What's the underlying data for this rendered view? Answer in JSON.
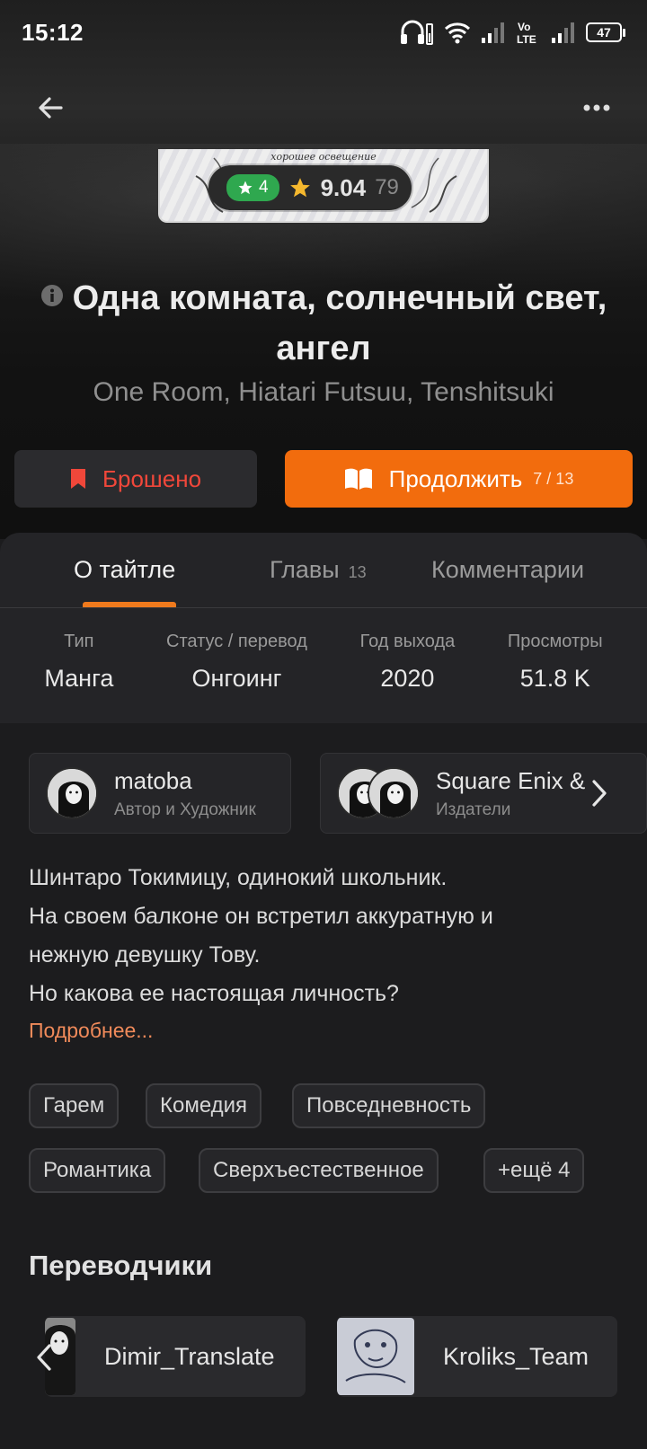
{
  "status_bar": {
    "time": "15:12",
    "battery": "47"
  },
  "cover": {
    "caption": "хорошее освещение"
  },
  "rating": {
    "user_score": "4",
    "score": "9.04",
    "votes": "79"
  },
  "title": {
    "main": "Одна комната, солнечный свет, ангел",
    "alt": "One Room, Hiatari Futsuu, Tenshitsuki"
  },
  "actions": {
    "status_label": "Брошено",
    "continue_label": "Продолжить",
    "continue_progress": "7 / 13"
  },
  "tabs": [
    {
      "label": "О тайтле"
    },
    {
      "label": "Главы",
      "count": "13"
    },
    {
      "label": "Комментарии"
    }
  ],
  "stats": [
    {
      "label": "Тип",
      "value": "Манга"
    },
    {
      "label": "Статус / перевод",
      "value": "Онгоинг"
    },
    {
      "label": "Год выхода",
      "value": "2020"
    },
    {
      "label": "Просмотры",
      "value": "51.8 K"
    }
  ],
  "authors": [
    {
      "name": "matoba",
      "role": "Автор и Художник"
    },
    {
      "name": "Square Enix &",
      "role": "Издатели"
    }
  ],
  "description": {
    "lines": [
      "Шинтаро Токимицу, одинокий школьник.",
      "На своем балконе он встретил аккуратную и",
      "нежную девушку Тову.",
      "Но какова ее настоящая личность?"
    ],
    "more": "Подробнее..."
  },
  "tags": [
    "Гарем",
    "Комедия",
    "Повседневность",
    "Романтика",
    "Сверхъестественное",
    "+ещё 4"
  ],
  "translators": {
    "title": "Переводчики",
    "items": [
      {
        "name": "Dimir_Translate"
      },
      {
        "name": "Kroliks_Team"
      }
    ]
  },
  "colors": {
    "accent": "#f26c0d",
    "status_red": "#f0473a",
    "rating_green": "#2fa84f",
    "background": "#1c1c1e"
  }
}
